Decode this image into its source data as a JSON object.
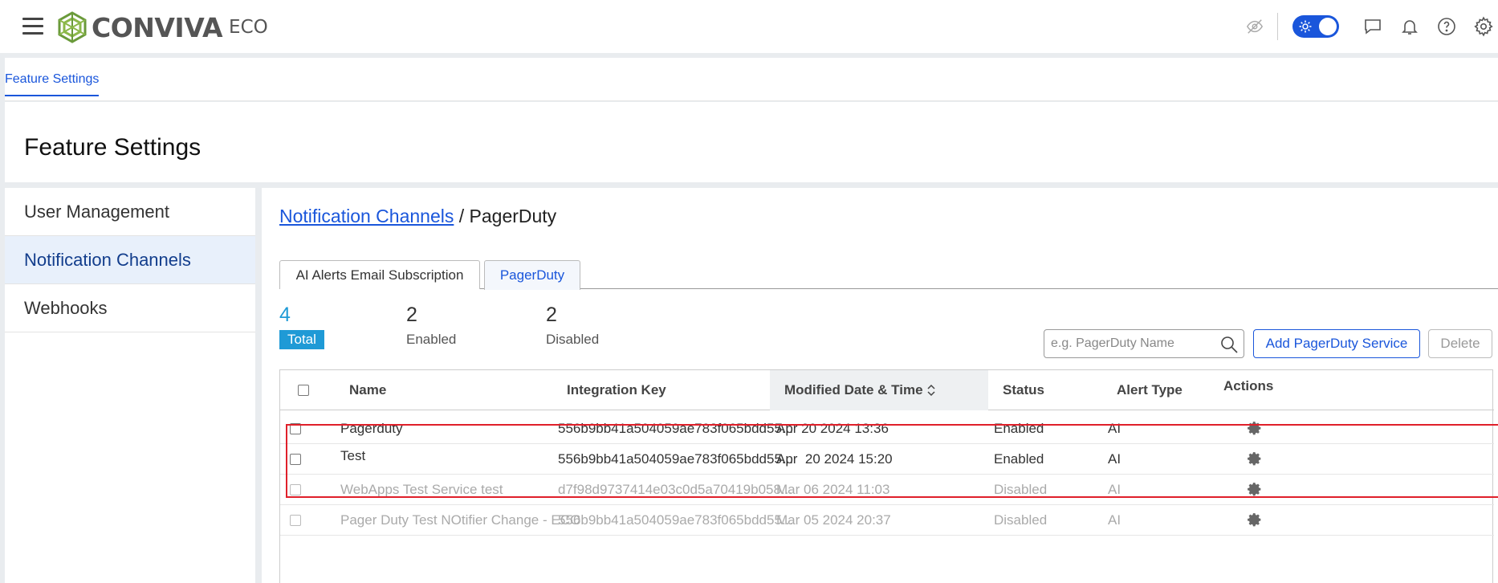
{
  "header": {
    "logo_text": "CONVIVA",
    "logo_sub": "ECO",
    "icons": [
      "menu-icon",
      "eye-off-icon",
      "sun-icon",
      "chat-icon",
      "bell-icon",
      "help-icon",
      "settings-icon"
    ]
  },
  "subnav": {
    "tab": "Feature Settings"
  },
  "page": {
    "title": "Feature Settings"
  },
  "sidebar": {
    "items": [
      {
        "label": "User Management"
      },
      {
        "label": "Notification Channels"
      },
      {
        "label": "Webhooks"
      }
    ]
  },
  "breadcrumb": {
    "link": "Notification Channels",
    "separator": " / ",
    "current": "PagerDuty"
  },
  "tabs": [
    {
      "label": "AI Alerts Email Subscription"
    },
    {
      "label": "PagerDuty"
    }
  ],
  "stats": {
    "total": {
      "value": "4",
      "label": "Total"
    },
    "enabled": {
      "value": "2",
      "label": "Enabled"
    },
    "disabled": {
      "value": "2",
      "label": "Disabled"
    }
  },
  "search": {
    "placeholder": "e.g. PagerDuty Name"
  },
  "buttons": {
    "add": "Add PagerDuty Service",
    "delete": "Delete"
  },
  "table": {
    "columns": {
      "name": "Name",
      "key": "Integration Key",
      "modified": "Modified Date & Time",
      "status": "Status",
      "alert_type": "Alert Type",
      "actions": "Actions"
    },
    "rows": [
      {
        "name": "Pagerduty",
        "key": "556b9bb41a504059ae783f065bdd55...",
        "modified": "Apr 20 2024 13:36",
        "status": "Enabled",
        "alert_type": "AI"
      },
      {
        "name": "Test",
        "key": "556b9bb41a504059ae783f065bdd55...",
        "modified": "Apr  20 2024 15:20",
        "status": "Enabled",
        "alert_type": "AI"
      },
      {
        "name": "WebApps Test Service test",
        "key": "d7f98d9737414e03c0d5a70419b058...",
        "modified": "Mar 06 2024 11:03",
        "status": "Disabled",
        "alert_type": "AI"
      },
      {
        "name": "Pager Duty Test NOtifier Change - ECO",
        "key": "556b9bb41a504059ae783f065bdd55...",
        "modified": "Mar 05 2024 20:37",
        "status": "Disabled",
        "alert_type": "AI"
      }
    ]
  },
  "colors": {
    "accent": "#1a56db",
    "total": "#1f9ad6",
    "highlight": "#e0202a"
  }
}
